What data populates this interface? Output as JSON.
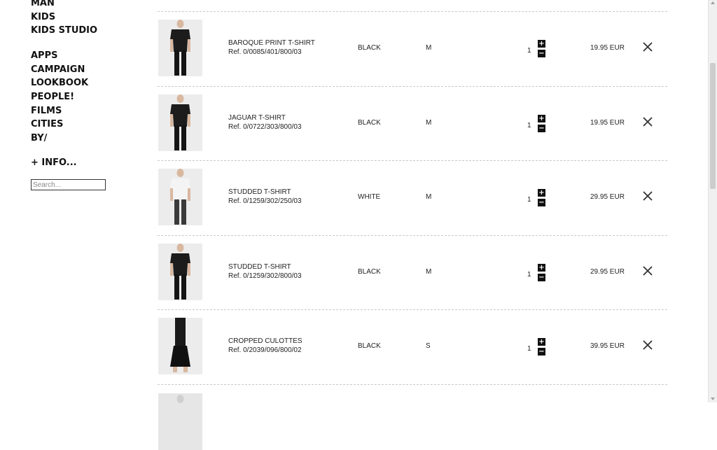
{
  "sidebar": {
    "nav_primary": [
      "MAN",
      "KIDS",
      "KIDS STUDIO"
    ],
    "nav_secondary": [
      "APPS",
      "CAMPAIGN",
      "LOOKBOOK",
      "PEOPLE!",
      "FILMS",
      "CITIES",
      "BY/"
    ],
    "info_label": "+ INFO...",
    "search_placeholder": "Search..."
  },
  "cart": {
    "items": [
      {
        "name": "BAROQUE PRINT T-SHIRT",
        "ref": "Ref. 0/0085/401/800/03",
        "color": "BLACK",
        "size": "M",
        "qty": "1",
        "price": "19.95 EUR",
        "garment": "dark"
      },
      {
        "name": "JAGUAR T-SHIRT",
        "ref": "Ref. 0/0722/303/800/03",
        "color": "BLACK",
        "size": "M",
        "qty": "1",
        "price": "19.95 EUR",
        "garment": "dark"
      },
      {
        "name": "STUDDED T-SHIRT",
        "ref": "Ref. 0/1259/302/250/03",
        "color": "WHITE",
        "size": "M",
        "qty": "1",
        "price": "29.95 EUR",
        "garment": "white"
      },
      {
        "name": "STUDDED T-SHIRT",
        "ref": "Ref. 0/1259/302/800/03",
        "color": "BLACK",
        "size": "M",
        "qty": "1",
        "price": "29.95 EUR",
        "garment": "dark"
      },
      {
        "name": "CROPPED CULOTTES",
        "ref": "Ref. 0/2039/096/800/02",
        "color": "BLACK",
        "size": "S",
        "qty": "1",
        "price": "39.95 EUR",
        "garment": "culottes"
      }
    ],
    "plus_glyph": "+",
    "minus_glyph": "−"
  }
}
